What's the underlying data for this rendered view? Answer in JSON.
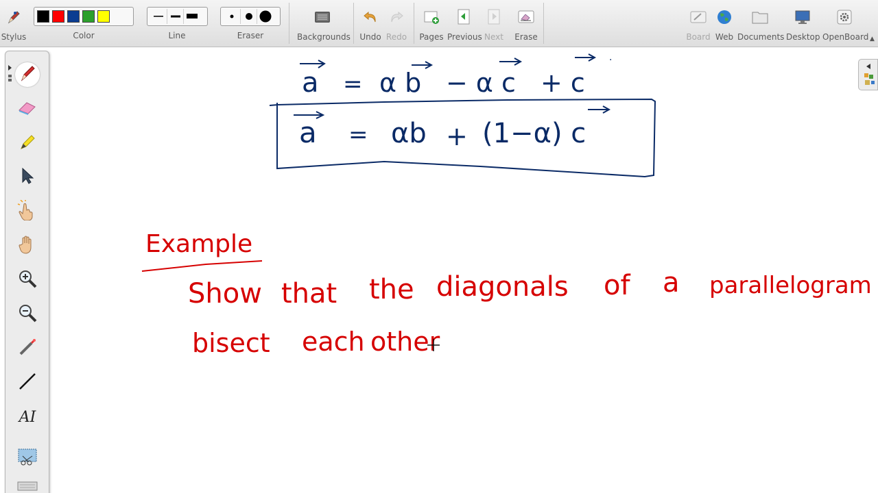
{
  "toolbar": {
    "stylus_label": "Stylus",
    "color_label": "Color",
    "line_label": "Line",
    "eraser_label": "Eraser",
    "colors": [
      "#000000",
      "#ff0000",
      "#0b3d91",
      "#2ca02c",
      "#ffff00"
    ],
    "buttons": {
      "backgrounds": "Backgrounds",
      "undo": "Undo",
      "redo": "Redo",
      "pages": "Pages",
      "previous": "Previous",
      "next": "Next",
      "erase": "Erase",
      "board": "Board",
      "web": "Web",
      "documents": "Documents",
      "desktop": "Desktop",
      "openboard": "OpenBoard"
    }
  },
  "palette": {
    "tools": [
      "pen-icon",
      "eraser-icon",
      "highlighter-icon",
      "pointer-icon",
      "interact-icon",
      "hand-icon",
      "zoom-in-icon",
      "zoom-out-icon",
      "laser-icon",
      "line-icon",
      "text-icon",
      "capture-icon",
      "keyboard-icon"
    ],
    "text_tool_glyph": "AI"
  },
  "board": {
    "ink_blue": "#0a2a66",
    "ink_red": "#d60000",
    "eq1": {
      "a": "a",
      "eq": "=",
      "t1": "α b",
      "minus": "− α c",
      "plus": "+ c",
      "dot": "."
    },
    "eq2": {
      "a": "a",
      "eq": "=",
      "t1": "αb",
      "plus": "+",
      "t2": "(1−α) c"
    },
    "example_title": "Example",
    "line1_words": [
      "Show",
      "that",
      "the",
      "diagonals",
      "of",
      "a",
      "parallelogram"
    ],
    "line2_words": [
      "bisect",
      "each",
      "other"
    ]
  }
}
